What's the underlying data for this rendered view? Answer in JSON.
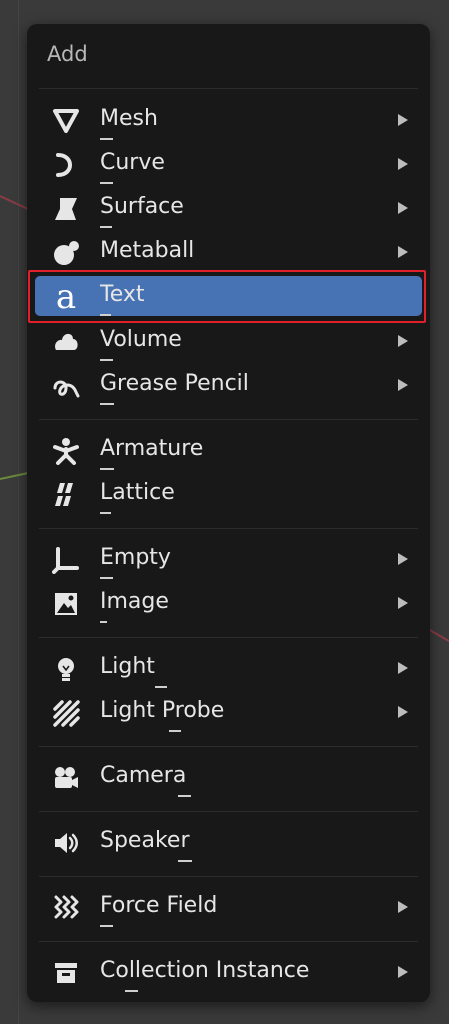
{
  "menu": {
    "title": "Add",
    "items": [
      {
        "label": "Mesh",
        "icon": "mesh-icon",
        "submenu": true
      },
      {
        "label": "Curve",
        "icon": "curve-icon",
        "submenu": true
      },
      {
        "label": "Surface",
        "icon": "surface-icon",
        "submenu": true
      },
      {
        "label": "Metaball",
        "icon": "metaball-icon",
        "submenu": true
      },
      {
        "label": "Text",
        "icon": "text-icon",
        "submenu": false,
        "active": true
      },
      {
        "label": "Volume",
        "icon": "volume-icon",
        "submenu": true
      },
      {
        "label": "Grease Pencil",
        "icon": "grease-pencil-icon",
        "submenu": true
      },
      {
        "label": "Armature",
        "icon": "armature-icon",
        "submenu": false
      },
      {
        "label": "Lattice",
        "icon": "lattice-icon",
        "submenu": false
      },
      {
        "label": "Empty",
        "icon": "empty-icon",
        "submenu": true
      },
      {
        "label": "Image",
        "icon": "image-icon",
        "submenu": true
      },
      {
        "label": "Light",
        "icon": "light-icon",
        "submenu": true
      },
      {
        "label": "Light Probe",
        "icon": "light-probe-icon",
        "submenu": true
      },
      {
        "label": "Camera",
        "icon": "camera-icon",
        "submenu": false
      },
      {
        "label": "Speaker",
        "icon": "speaker-icon",
        "submenu": false
      },
      {
        "label": "Force Field",
        "icon": "force-field-icon",
        "submenu": true
      },
      {
        "label": "Collection Instance",
        "icon": "collection-instance-icon",
        "submenu": true
      }
    ]
  },
  "colors": {
    "menu_bg": "#181818",
    "active_bg": "#4772b3",
    "highlight_border": "#e0212b",
    "text": "#e6e6e6"
  }
}
